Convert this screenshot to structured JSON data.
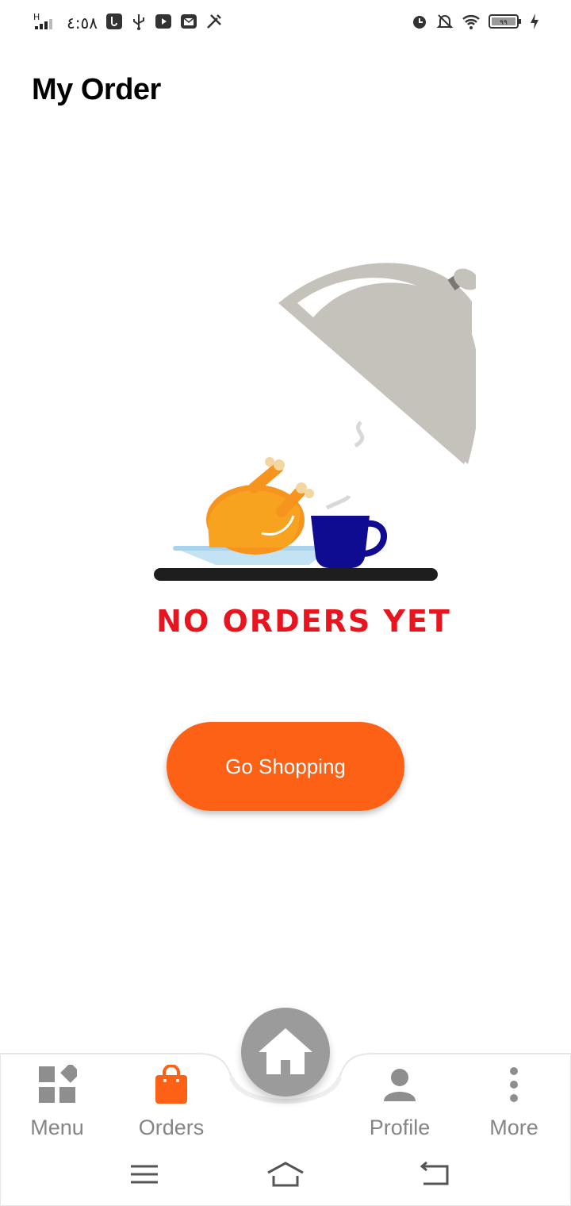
{
  "status_bar": {
    "network": "H",
    "time": "٤:٥٨",
    "battery": "٩٩"
  },
  "header": {
    "title": "My Order"
  },
  "empty_state": {
    "message": "NO ORDERS YET",
    "button_label": "Go Shopping"
  },
  "bottom_nav": {
    "items": [
      {
        "label": "Menu",
        "icon": "grid-icon",
        "active": false
      },
      {
        "label": "Orders",
        "icon": "shopping-bag-icon",
        "active": true
      },
      {
        "label": "Profile",
        "icon": "person-icon",
        "active": false
      },
      {
        "label": "More",
        "icon": "more-vertical-icon",
        "active": false
      }
    ],
    "home_icon": "home-icon"
  },
  "colors": {
    "accent": "#fc6116",
    "nav_inactive": "#858585",
    "empty_text": "#e8141e",
    "fab": "#9b9b9b"
  }
}
